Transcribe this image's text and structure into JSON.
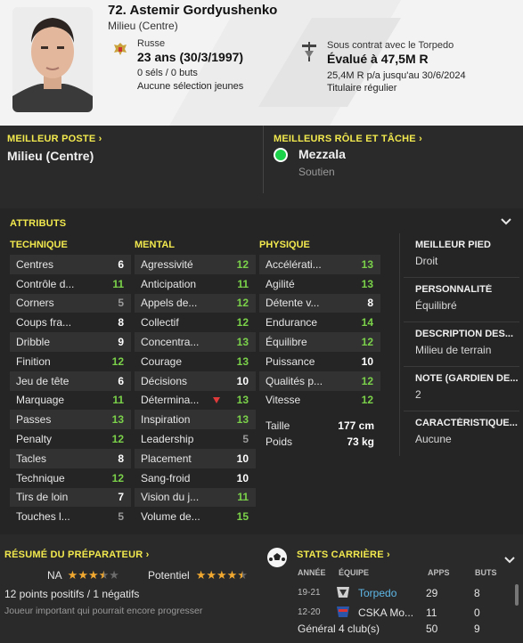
{
  "header": {
    "name": "72. Astemir Gordyushenko",
    "position": "Milieu (Centre)",
    "nationality": "Russe",
    "age": "23 ans (30/3/1997)",
    "caps": "0 séls / 0 buts",
    "youth_caps": "Aucune sélection jeunes",
    "contract_label": "Sous contrat avec le Torpedo",
    "value": "Évalué à 47,5M R",
    "wage": "25,4M R p/a jusqu'au 30/6/2024",
    "status": "Titulaire régulier"
  },
  "positions": {
    "best_position_title": "MEILLEUR POSTE",
    "best_position": "Milieu (Centre)",
    "best_role_title": "MEILLEURS RÔLE ET TÂCHE",
    "role": "Mezzala",
    "duty": "Soutien",
    "role_dot_color": "#1bd24a"
  },
  "attributes": {
    "title": "ATTRIBUTS",
    "technical_title": "TECHNIQUE",
    "mental_title": "MENTAL",
    "physical_title": "PHYSIQUE",
    "technical": [
      {
        "name": "Centres",
        "value": "6",
        "tone": "white"
      },
      {
        "name": "Contrôle d...",
        "value": "11",
        "tone": "green"
      },
      {
        "name": "Corners",
        "value": "5",
        "tone": "grey"
      },
      {
        "name": "Coups fra...",
        "value": "8",
        "tone": "white"
      },
      {
        "name": "Dribble",
        "value": "9",
        "tone": "white"
      },
      {
        "name": "Finition",
        "value": "12",
        "tone": "green"
      },
      {
        "name": "Jeu de tête",
        "value": "6",
        "tone": "white"
      },
      {
        "name": "Marquage",
        "value": "11",
        "tone": "green"
      },
      {
        "name": "Passes",
        "value": "13",
        "tone": "green"
      },
      {
        "name": "Penalty",
        "value": "12",
        "tone": "green"
      },
      {
        "name": "Tacles",
        "value": "8",
        "tone": "white"
      },
      {
        "name": "Technique",
        "value": "12",
        "tone": "green"
      },
      {
        "name": "Tirs de loin",
        "value": "7",
        "tone": "white"
      },
      {
        "name": "Touches l...",
        "value": "5",
        "tone": "grey"
      }
    ],
    "mental": [
      {
        "name": "Agressivité",
        "value": "12",
        "tone": "green"
      },
      {
        "name": "Anticipation",
        "value": "11",
        "tone": "green"
      },
      {
        "name": "Appels de...",
        "value": "12",
        "tone": "green"
      },
      {
        "name": "Collectif",
        "value": "12",
        "tone": "green"
      },
      {
        "name": "Concentra...",
        "value": "13",
        "tone": "green"
      },
      {
        "name": "Courage",
        "value": "13",
        "tone": "green"
      },
      {
        "name": "Décisions",
        "value": "10",
        "tone": "white"
      },
      {
        "name": "Détermina...",
        "value": "13",
        "tone": "green",
        "down": true
      },
      {
        "name": "Inspiration",
        "value": "13",
        "tone": "green"
      },
      {
        "name": "Leadership",
        "value": "5",
        "tone": "grey"
      },
      {
        "name": "Placement",
        "value": "10",
        "tone": "white"
      },
      {
        "name": "Sang-froid",
        "value": "10",
        "tone": "white"
      },
      {
        "name": "Vision du j...",
        "value": "11",
        "tone": "green"
      },
      {
        "name": "Volume de...",
        "value": "15",
        "tone": "green"
      }
    ],
    "physical": [
      {
        "name": "Accélérati...",
        "value": "13",
        "tone": "green"
      },
      {
        "name": "Agilité",
        "value": "13",
        "tone": "green"
      },
      {
        "name": "Détente v...",
        "value": "8",
        "tone": "white"
      },
      {
        "name": "Endurance",
        "value": "14",
        "tone": "green"
      },
      {
        "name": "Équilibre",
        "value": "12",
        "tone": "green"
      },
      {
        "name": "Puissance",
        "value": "10",
        "tone": "white"
      },
      {
        "name": "Qualités p...",
        "value": "12",
        "tone": "green"
      },
      {
        "name": "Vitesse",
        "value": "12",
        "tone": "green"
      }
    ],
    "height_label": "Taille",
    "height": "177 cm",
    "weight_label": "Poids",
    "weight": "73 kg"
  },
  "side": [
    {
      "title": "MEILLEUR PIED",
      "value": "Droit"
    },
    {
      "title": "PERSONNALITÉ",
      "value": "Équilibré"
    },
    {
      "title": "DESCRIPTION DES...",
      "value": "Milieu de terrain"
    },
    {
      "title": "NOTE (GARDIEN DE...",
      "value": "2"
    },
    {
      "title": "CARACTÉRISTIQUE...",
      "value": "Aucune"
    }
  ],
  "coach": {
    "title": "RÉSUMÉ DU PRÉPARATEUR",
    "na_label": "NA",
    "na_stars": 3.5,
    "potential_label": "Potentiel",
    "potential_stars": 4.5,
    "summary": "12 points positifs / 1 négatifs",
    "description": "Joueur important qui pourrait encore progresser"
  },
  "career": {
    "title": "STATS CARRIÈRE",
    "headers": {
      "year": "ANNÉE",
      "team": "ÉQUIPE",
      "apps": "APPS",
      "goals": "BUTS"
    },
    "rows": [
      {
        "year": "19-21",
        "team": "Torpedo",
        "apps": "29",
        "goals": "8",
        "highlight": true
      },
      {
        "year": "12-20",
        "team": "CSKA Mo...",
        "apps": "11",
        "goals": "0",
        "highlight": false
      }
    ],
    "total_label": "Général 4 club(s)",
    "total_apps": "50",
    "total_goals": "9"
  },
  "colors": {
    "accent_yellow": "#f2e94e",
    "attr_green": "#7bd24a",
    "link_blue": "#5fb8e8",
    "star_gold": "#f0a830"
  }
}
